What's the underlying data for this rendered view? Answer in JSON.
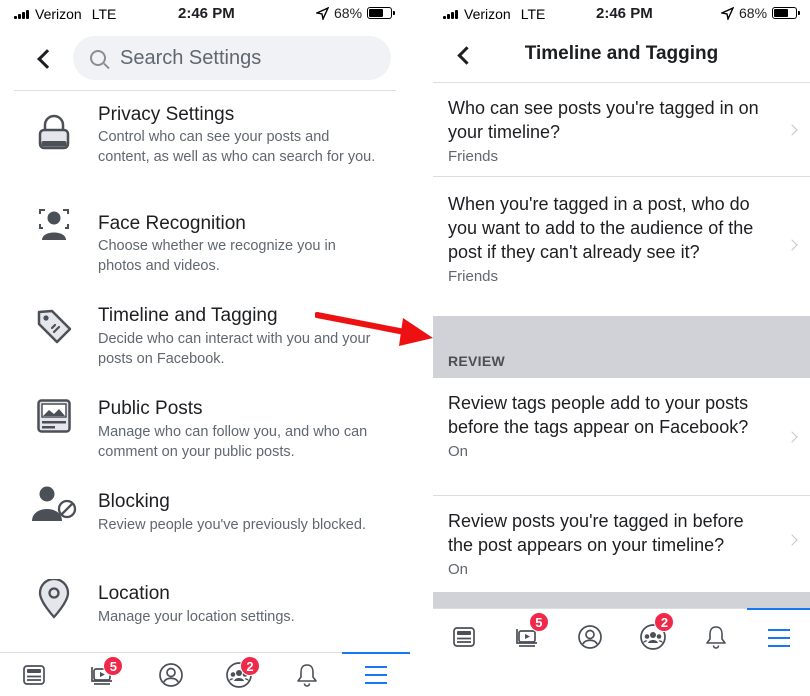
{
  "status_bar": {
    "carrier": "Verizon",
    "network": "LTE",
    "time": "2:46 PM",
    "battery": "68%",
    "battery_level": 0.68
  },
  "left": {
    "search": {
      "placeholder": "Search Settings"
    },
    "items": [
      {
        "title": "Privacy Settings",
        "description": "Control who can see your posts and content, as well as who can search for you.",
        "icon": "padlock-icon"
      },
      {
        "title": "Face Recognition",
        "description": "Choose whether we recognize you in photos and videos.",
        "icon": "face-recognition-icon"
      },
      {
        "title": "Timeline and Tagging",
        "description": "Decide who can interact with you and your posts on Facebook.",
        "icon": "tag-icon"
      },
      {
        "title": "Public Posts",
        "description": "Manage who can follow you, and who can comment on your public posts.",
        "icon": "public-post-icon"
      },
      {
        "title": "Blocking",
        "description": "Review people you've previously blocked.",
        "icon": "blocked-user-icon"
      },
      {
        "title": "Location",
        "description": "Manage your location settings.",
        "icon": "location-pin-icon"
      }
    ]
  },
  "right": {
    "title": "Timeline and Tagging",
    "options_top": [
      {
        "question": "Who can see posts you're tagged in on your timeline?",
        "value": "Friends"
      },
      {
        "question": "When you're tagged in a post, who do you want to add to the audience of the post if they can't already see it?",
        "value": "Friends"
      }
    ],
    "section": "REVIEW",
    "options_review": [
      {
        "question": "Review tags people add to your posts before the tags appear on Facebook?",
        "value": "On"
      },
      {
        "question": "Review posts you're tagged in before the post appears on your timeline?",
        "value": "On"
      }
    ]
  },
  "bottom_nav": {
    "items": [
      {
        "icon": "news-feed-icon"
      },
      {
        "icon": "watch-video-icon",
        "badge": "5"
      },
      {
        "icon": "profile-icon"
      },
      {
        "icon": "groups-icon",
        "badge": "2"
      },
      {
        "icon": "notifications-bell-icon"
      },
      {
        "icon": "menu-icon",
        "active": true
      }
    ]
  },
  "colors": {
    "accent": "#1877f2",
    "badge": "#f02849",
    "arrow": "#ee1111",
    "section_band": "#d0d2d7"
  }
}
